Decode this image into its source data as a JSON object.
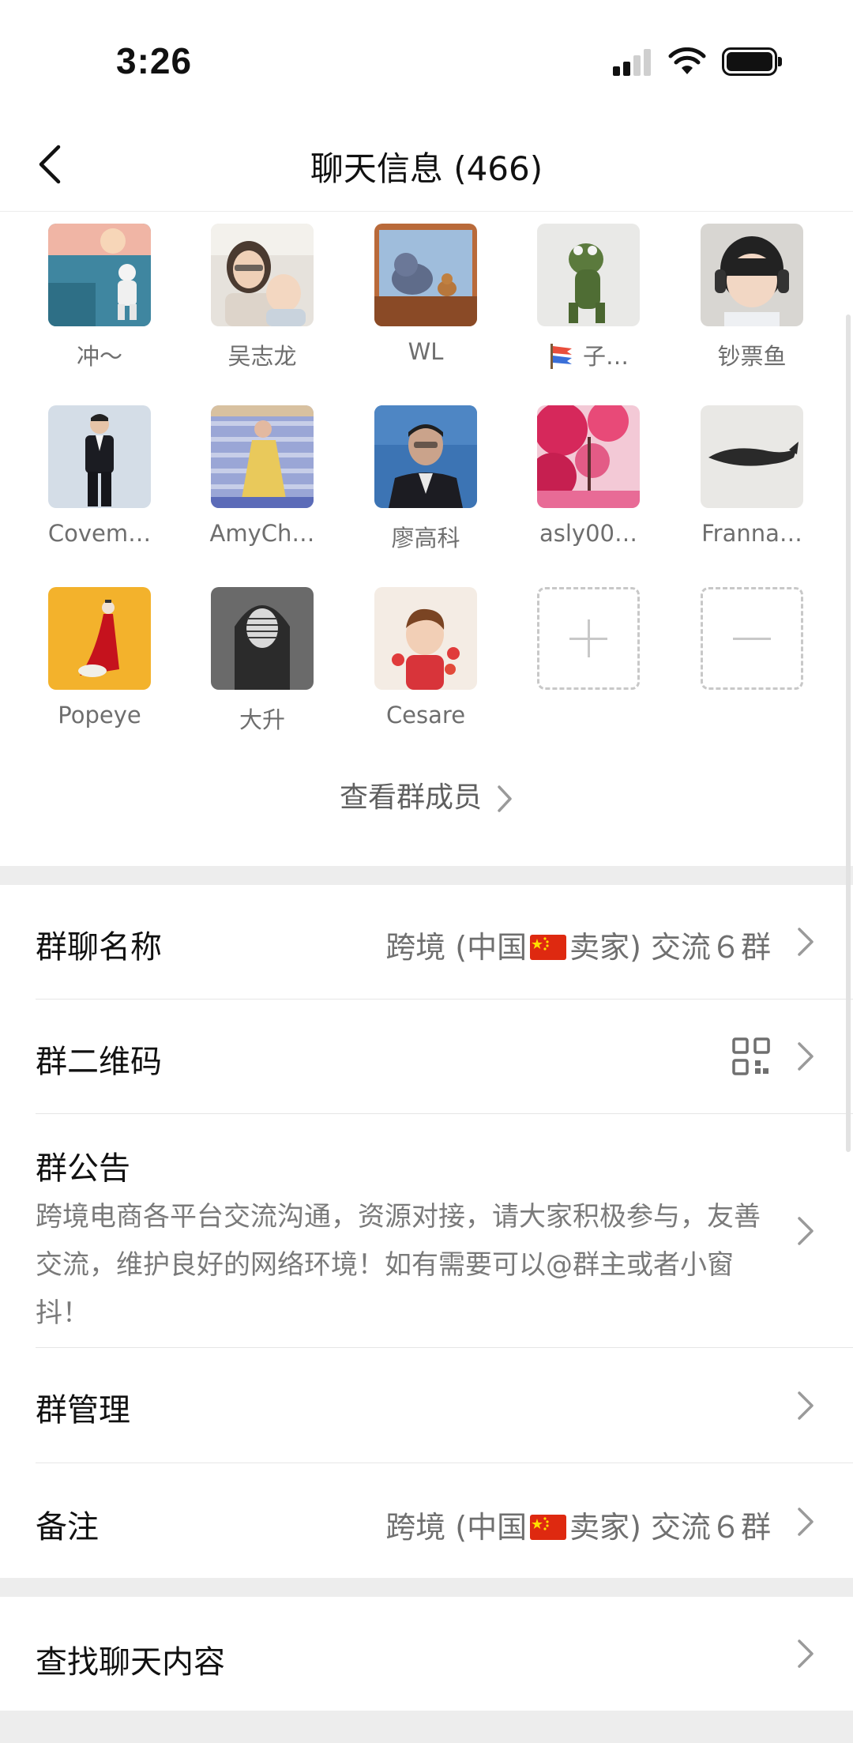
{
  "status_bar": {
    "time": "3:26"
  },
  "header": {
    "title": "聊天信息 (466)"
  },
  "members": [
    {
      "name": "冲～",
      "avatar": "astronaut-avatar"
    },
    {
      "name": "吴志龙",
      "avatar": "mother-child-avatar"
    },
    {
      "name": "WL",
      "avatar": "tom-jerry-avatar"
    },
    {
      "name": "子…",
      "prefix_icon": "carp-streamer-icon",
      "avatar": "frog-toy-avatar"
    },
    {
      "name": "钞票鱼",
      "avatar": "child-headphones-avatar"
    },
    {
      "name": "Covem…",
      "avatar": "man-tuxedo-avatar"
    },
    {
      "name": "AmyCh…",
      "avatar": "woman-stairs-avatar"
    },
    {
      "name": "廖高科",
      "avatar": "man-portrait-avatar"
    },
    {
      "name": "asly00…",
      "avatar": "pink-blossoms-avatar"
    },
    {
      "name": "Franna…",
      "avatar": "whale-avatar"
    },
    {
      "name": "Popeye",
      "avatar": "figure-cape-avatar"
    },
    {
      "name": "大升",
      "avatar": "hooded-figure-avatar"
    },
    {
      "name": "Cesare",
      "avatar": "cartoon-boy-avatar"
    }
  ],
  "view_members_label": "查看群成员",
  "settings": {
    "group_name": {
      "label": "群聊名称",
      "value_before": "跨境 (中国",
      "flag_icon": "china-flag-icon",
      "value_after": "卖家) 交流６群"
    },
    "qr_code": {
      "label": "群二维码",
      "icon": "qr-code-icon"
    },
    "announcement": {
      "label": "群公告",
      "text": "跨境电商各平台交流沟通，资源对接，请大家积极参与，友善交流，维护良好的网络环境！如有需要可以@群主或者小窗抖！"
    },
    "management": {
      "label": "群管理"
    },
    "remark": {
      "label": "备注",
      "value_before": "跨境 (中国",
      "flag_icon": "china-flag-icon",
      "value_after": "卖家) 交流６群"
    },
    "search": {
      "label": "查找聊天内容"
    }
  },
  "colors": {
    "separator": "#ededed",
    "secondary_text": "#6f6f6f",
    "dashed_border": "#c8c8c8",
    "flag_red": "#de2910",
    "flag_yellow": "#ffde00"
  }
}
